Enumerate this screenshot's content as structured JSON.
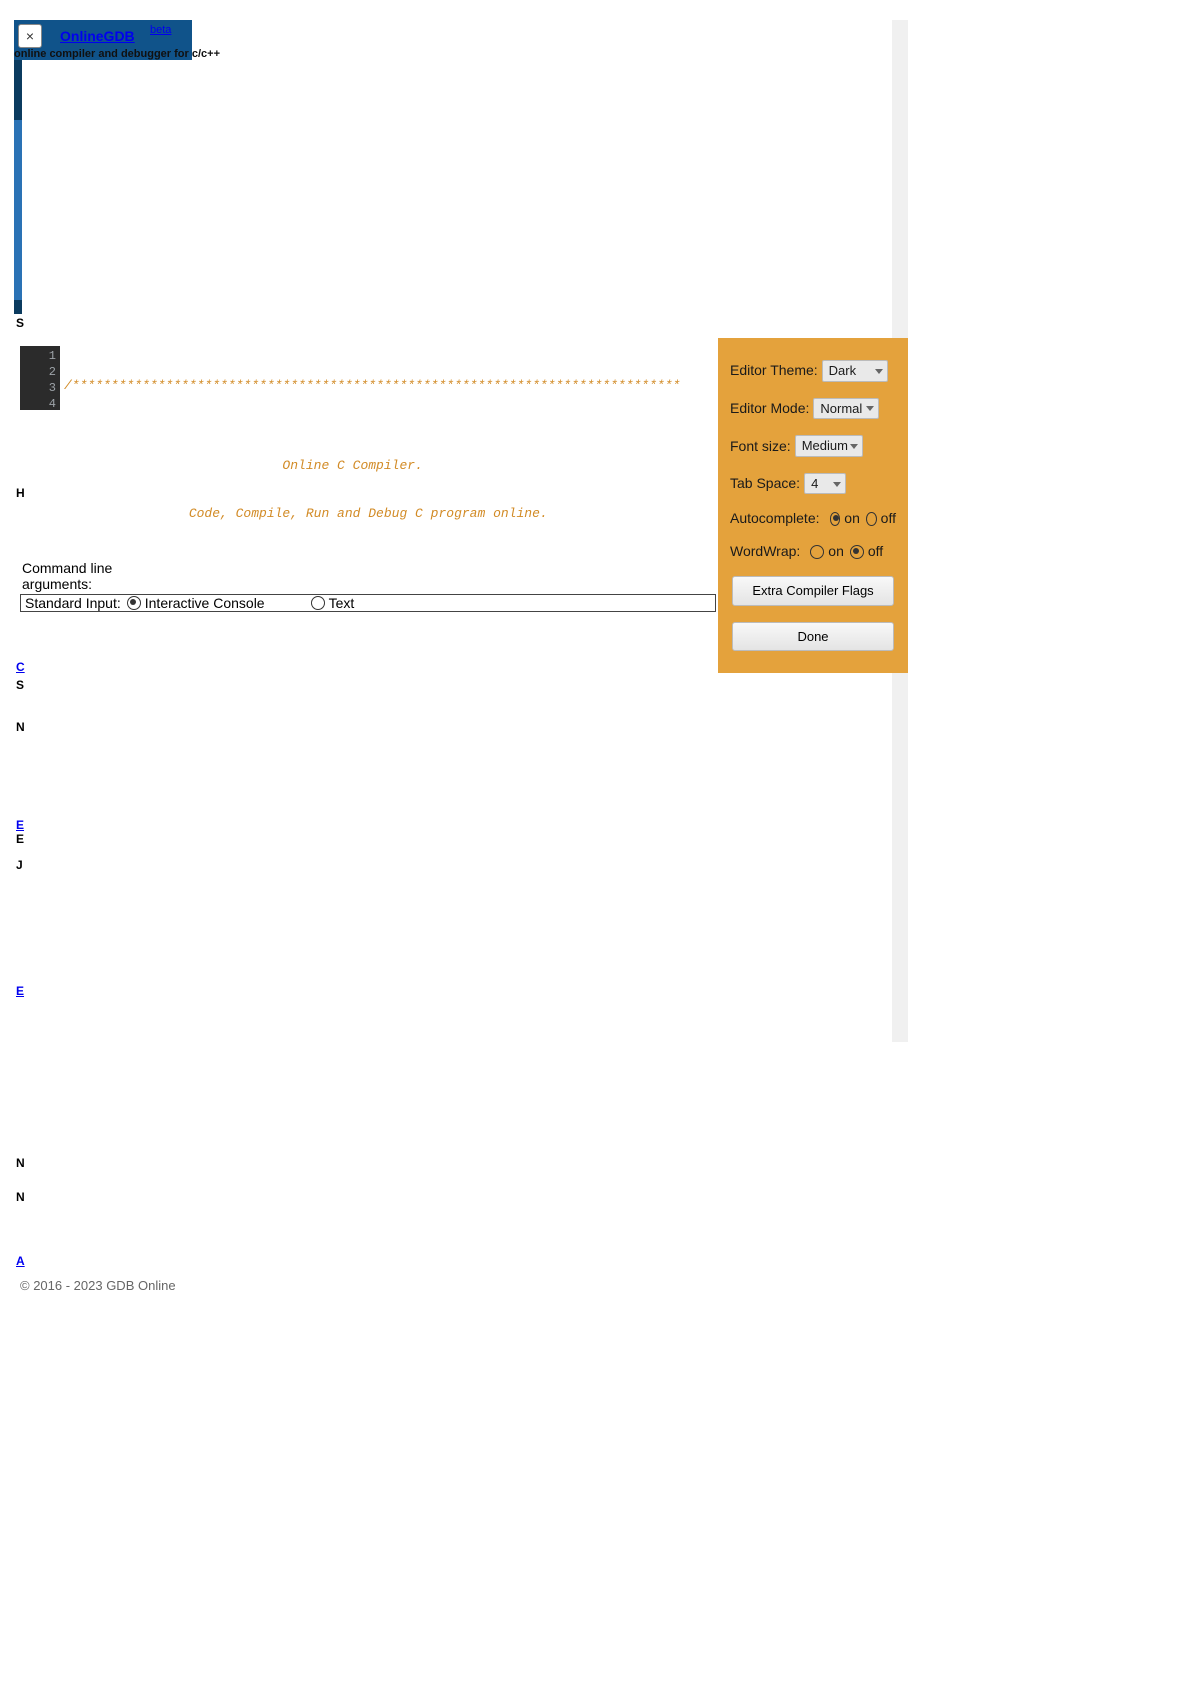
{
  "header": {
    "brand": "OnlineGDB",
    "beta": "beta",
    "subtitle": "online compiler and debugger for c/c++",
    "close": "×"
  },
  "editor": {
    "line_numbers": [
      "1",
      "2",
      "3",
      "4"
    ],
    "code_lines": [
      "/******************************************************************************",
      "",
      "                            Online C Compiler.",
      "                Code, Compile, Run and Debug C program online."
    ]
  },
  "cmdline": {
    "label": "Command line arguments:"
  },
  "stdin": {
    "label": "Standard Input:",
    "opt_interactive": "Interactive Console",
    "opt_text": "Text"
  },
  "settings": {
    "theme_label": "Editor Theme:",
    "theme_value": "Dark",
    "mode_label": "Editor Mode:",
    "mode_value": "Normal",
    "font_label": "Font size:",
    "font_value": "Medium",
    "tab_label": "Tab Space:",
    "tab_value": "4",
    "ac_label": "Autocomplete:",
    "ac_on": "on",
    "ac_off": "off",
    "ww_label": "WordWrap:",
    "ww_on": "on",
    "ww_off": "off",
    "flags_btn": "Extra Compiler Flags",
    "done_btn": "Done"
  },
  "footer": {
    "copyright": "© 2016 - 2023 GDB Online"
  },
  "peeks": {
    "s1": "S",
    "h1": "H",
    "c1": "C",
    "s2": "S",
    "n1": "N",
    "e1": "E",
    "e2": "E",
    "j1": "J",
    "e3": "E",
    "n2": "N",
    "n3": "N",
    "a1": "A"
  }
}
